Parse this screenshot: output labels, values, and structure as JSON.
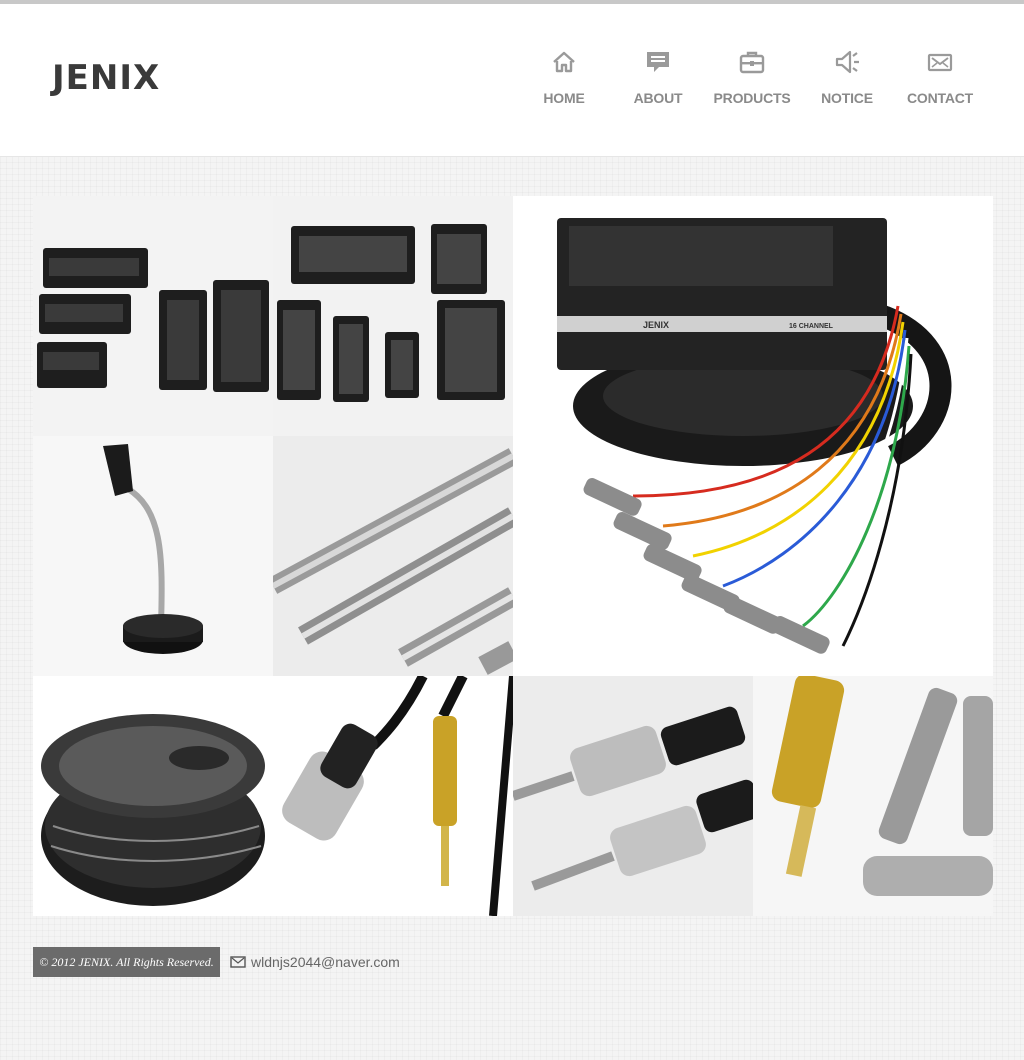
{
  "brand": {
    "logo": "JENIX"
  },
  "nav": [
    {
      "label": "HOME",
      "icon": "home-icon"
    },
    {
      "label": "ABOUT",
      "icon": "speech-bubble-icon"
    },
    {
      "label": "PRODUCTS",
      "icon": "briefcase-icon"
    },
    {
      "label": "NOTICE",
      "icon": "megaphone-icon"
    },
    {
      "label": "CONTACT",
      "icon": "envelope-icon"
    }
  ],
  "gallery": {
    "stagebox_label": "JENIX",
    "stagebox_channel": "16 CHANNEL"
  },
  "footer": {
    "copyright": "© 2012 JENIX. All Rights Reserved.",
    "email": "wldnjs2044@naver.com",
    "email_icon": "envelope-icon"
  },
  "colors": {
    "nav_text": "#8a8a8a",
    "logo": "#3a3a3a",
    "footer_badge": "#6b6b6b"
  }
}
